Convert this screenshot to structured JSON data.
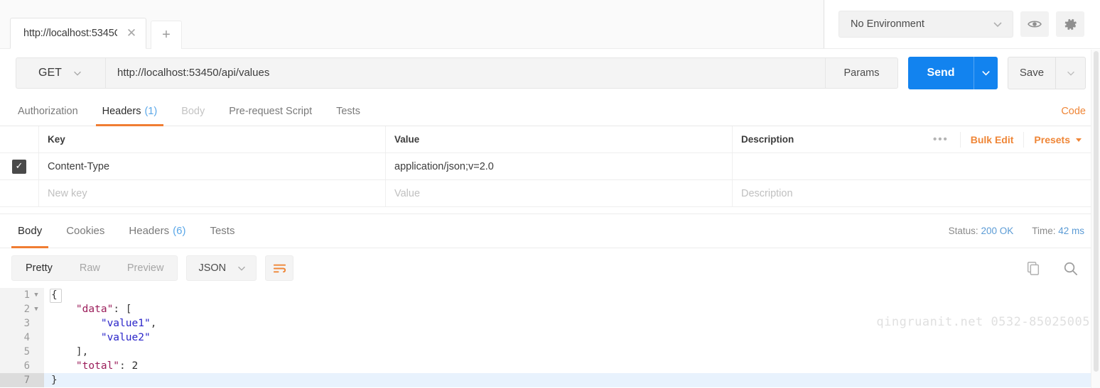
{
  "topbar": {
    "tab": {
      "label": "http://localhost:5345C",
      "close_icon": "close-icon"
    },
    "new_tab_label": "+",
    "environment": {
      "selected": "No Environment",
      "caret_icon": "chevron-down-icon",
      "eye_icon": "eye-icon",
      "gear_icon": "gear-icon"
    }
  },
  "request": {
    "method": "GET",
    "url": "http://localhost:53450/api/values",
    "params_label": "Params",
    "send_label": "Send",
    "save_label": "Save",
    "send_color": "#1283ef",
    "tabs": [
      {
        "label": "Authorization",
        "state": "normal"
      },
      {
        "label": "Headers",
        "count": "(1)",
        "state": "active"
      },
      {
        "label": "Body",
        "state": "disabled"
      },
      {
        "label": "Pre-request Script",
        "state": "normal"
      },
      {
        "label": "Tests",
        "state": "normal"
      }
    ],
    "code_link": "Code",
    "accent_color": "#f07d33"
  },
  "headers_table": {
    "columns": [
      "Key",
      "Value",
      "Description"
    ],
    "actions": {
      "more_icon": "more-dots-icon",
      "bulk_edit": "Bulk Edit",
      "presets": "Presets"
    },
    "rows": [
      {
        "checked": true,
        "key": "Content-Type",
        "value": "application/json;v=2.0",
        "description": ""
      }
    ],
    "placeholder_row": {
      "key": "New key",
      "value": "Value",
      "description": "Description"
    }
  },
  "response": {
    "tabs": [
      {
        "label": "Body",
        "state": "active"
      },
      {
        "label": "Cookies",
        "state": "normal"
      },
      {
        "label": "Headers",
        "count": "(6)",
        "state": "normal"
      },
      {
        "label": "Tests",
        "state": "normal"
      }
    ],
    "status_label": "Status:",
    "status_value": "200 OK",
    "time_label": "Time:",
    "time_value": "42 ms",
    "value_color": "#5b9bd5",
    "toolbar": {
      "formats": [
        {
          "label": "Pretty",
          "state": "active"
        },
        {
          "label": "Raw",
          "state": "normal"
        },
        {
          "label": "Preview",
          "state": "normal"
        }
      ],
      "language": "JSON",
      "wrap_icon": "word-wrap-icon",
      "copy_icon": "copy-icon",
      "search_icon": "search-icon"
    },
    "body_lines": [
      {
        "num": "1",
        "fold": true,
        "active": false,
        "tokens": [
          {
            "t": "p",
            "v": "{"
          }
        ]
      },
      {
        "num": "2",
        "fold": true,
        "active": false,
        "tokens": [
          {
            "t": "p",
            "v": "    "
          },
          {
            "t": "k",
            "v": "\"data\""
          },
          {
            "t": "p",
            "v": ": ["
          }
        ]
      },
      {
        "num": "3",
        "fold": false,
        "active": false,
        "tokens": [
          {
            "t": "p",
            "v": "        "
          },
          {
            "t": "s",
            "v": "\"value1\""
          },
          {
            "t": "p",
            "v": ","
          }
        ]
      },
      {
        "num": "4",
        "fold": false,
        "active": false,
        "tokens": [
          {
            "t": "p",
            "v": "        "
          },
          {
            "t": "s",
            "v": "\"value2\""
          }
        ]
      },
      {
        "num": "5",
        "fold": false,
        "active": false,
        "tokens": [
          {
            "t": "p",
            "v": "    ],"
          }
        ]
      },
      {
        "num": "6",
        "fold": false,
        "active": false,
        "tokens": [
          {
            "t": "p",
            "v": "    "
          },
          {
            "t": "k",
            "v": "\"total\""
          },
          {
            "t": "p",
            "v": ": "
          },
          {
            "t": "n",
            "v": "2"
          }
        ]
      },
      {
        "num": "7",
        "fold": false,
        "active": true,
        "tokens": [
          {
            "t": "p",
            "v": "}"
          }
        ]
      }
    ],
    "watermark": "qingruanit.net 0532-85025005"
  }
}
